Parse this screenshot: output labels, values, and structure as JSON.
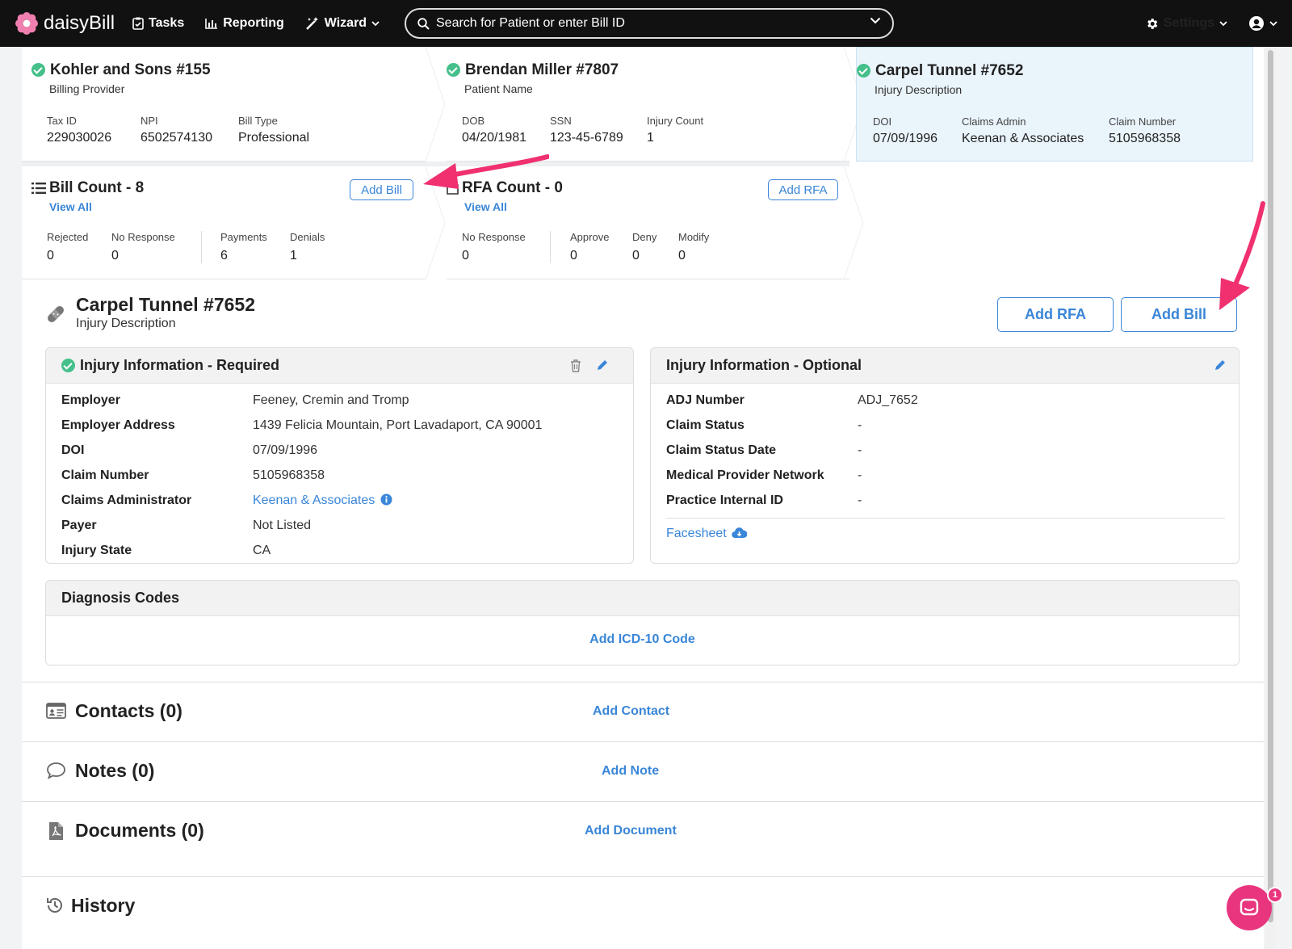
{
  "nav": {
    "brand": "daisyBill",
    "tasks": "Tasks",
    "reporting": "Reporting",
    "wizard": "Wizard",
    "search_placeholder": "Search for Patient or enter Bill ID",
    "settings": "Settings"
  },
  "provider": {
    "title": "Kohler and Sons #155",
    "subtitle": "Billing Provider",
    "fields": [
      {
        "label": "Tax ID",
        "value": "229030026"
      },
      {
        "label": "NPI",
        "value": "6502574130"
      },
      {
        "label": "Bill Type",
        "value": "Professional"
      }
    ]
  },
  "patient": {
    "title": "Brendan Miller #7807",
    "subtitle": "Patient Name",
    "fields": [
      {
        "label": "DOB",
        "value": "04/20/1981"
      },
      {
        "label": "SSN",
        "value": "123-45-6789"
      },
      {
        "label": "Injury Count",
        "value": "1"
      }
    ]
  },
  "injury_card": {
    "title": "Carpel Tunnel #7652",
    "subtitle": "Injury Description",
    "fields": [
      {
        "label": "DOI",
        "value": "07/09/1996"
      },
      {
        "label": "Claims Admin",
        "value": "Keenan & Associates"
      },
      {
        "label": "Claim Number",
        "value": "5105968358"
      }
    ]
  },
  "bills": {
    "title": "Bill Count - 8",
    "view_all": "View All",
    "add": "Add Bill",
    "stats": [
      {
        "label": "Rejected",
        "value": "0"
      },
      {
        "label": "No Response",
        "value": "0"
      },
      {
        "label": "Payments",
        "value": "6"
      },
      {
        "label": "Denials",
        "value": "1"
      }
    ]
  },
  "rfa": {
    "title": "RFA Count - 0",
    "view_all": "View All",
    "add": "Add RFA",
    "stats": [
      {
        "label": "No Response",
        "value": "0"
      },
      {
        "label": "Approve",
        "value": "0"
      },
      {
        "label": "Deny",
        "value": "0"
      },
      {
        "label": "Modify",
        "value": "0"
      }
    ]
  },
  "detail": {
    "title": "Carpel Tunnel #7652",
    "subtitle": "Injury Description",
    "add_rfa": "Add RFA",
    "add_bill": "Add Bill"
  },
  "required": {
    "title": "Injury Information - Required",
    "rows": [
      {
        "label": "Employer",
        "value": "Feeney, Cremin and Tromp"
      },
      {
        "label": "Employer Address",
        "value": "1439 Felicia Mountain, Port Lavadaport, CA 90001"
      },
      {
        "label": "DOI",
        "value": "07/09/1996"
      },
      {
        "label": "Claim Number",
        "value": "5105968358"
      },
      {
        "label": "Claims Administrator",
        "value": "Keenan & Associates"
      },
      {
        "label": "Payer",
        "value": "Not Listed"
      },
      {
        "label": "Injury State",
        "value": "CA"
      }
    ]
  },
  "optional": {
    "title": "Injury Information - Optional",
    "rows": [
      {
        "label": "ADJ Number",
        "value": "ADJ_7652"
      },
      {
        "label": "Claim Status",
        "value": "-"
      },
      {
        "label": "Claim Status Date",
        "value": "-"
      },
      {
        "label": "Medical Provider Network",
        "value": "-"
      },
      {
        "label": "Practice Internal ID",
        "value": "-"
      }
    ],
    "facesheet": "Facesheet"
  },
  "diagnosis": {
    "title": "Diagnosis Codes",
    "add": "Add ICD-10 Code"
  },
  "contacts": {
    "title": "Contacts (0)",
    "add": "Add Contact"
  },
  "notes": {
    "title": "Notes (0)",
    "add": "Add Note"
  },
  "documents": {
    "title": "Documents (0)",
    "add": "Add Document"
  },
  "history": {
    "title": "History"
  },
  "chat": {
    "badge": "1"
  },
  "colors": {
    "accent": "#3a86d8",
    "success": "#45c08b",
    "annotation": "#f0306f",
    "nav": "#111111"
  }
}
